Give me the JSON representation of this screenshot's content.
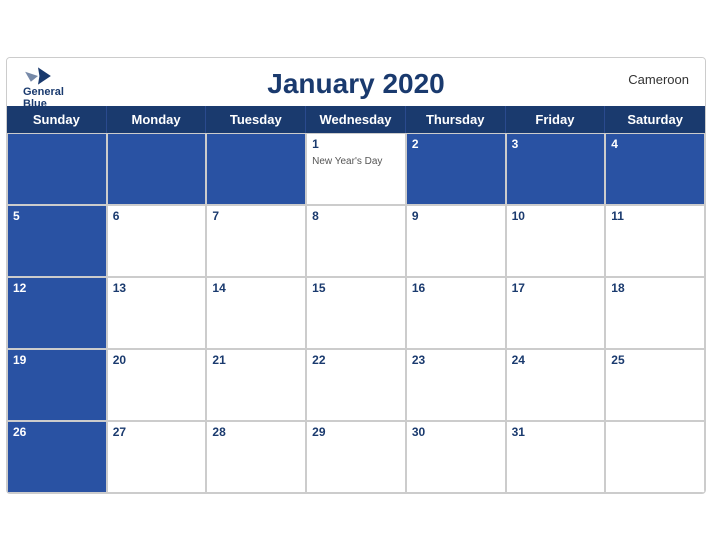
{
  "header": {
    "title": "January 2020",
    "country": "Cameroon",
    "logo_line1": "General",
    "logo_line2": "Blue"
  },
  "days_of_week": [
    "Sunday",
    "Monday",
    "Tuesday",
    "Wednesday",
    "Thursday",
    "Friday",
    "Saturday"
  ],
  "weeks": [
    [
      {
        "num": "",
        "blue": true,
        "event": ""
      },
      {
        "num": "",
        "blue": true,
        "event": ""
      },
      {
        "num": "",
        "blue": true,
        "event": ""
      },
      {
        "num": "1",
        "blue": false,
        "event": "New Year's Day"
      },
      {
        "num": "2",
        "blue": true,
        "event": ""
      },
      {
        "num": "3",
        "blue": true,
        "event": ""
      },
      {
        "num": "4",
        "blue": true,
        "event": ""
      }
    ],
    [
      {
        "num": "5",
        "blue": true,
        "event": ""
      },
      {
        "num": "6",
        "blue": false,
        "event": ""
      },
      {
        "num": "7",
        "blue": false,
        "event": ""
      },
      {
        "num": "8",
        "blue": false,
        "event": ""
      },
      {
        "num": "9",
        "blue": false,
        "event": ""
      },
      {
        "num": "10",
        "blue": false,
        "event": ""
      },
      {
        "num": "11",
        "blue": false,
        "event": ""
      }
    ],
    [
      {
        "num": "12",
        "blue": true,
        "event": ""
      },
      {
        "num": "13",
        "blue": false,
        "event": ""
      },
      {
        "num": "14",
        "blue": false,
        "event": ""
      },
      {
        "num": "15",
        "blue": false,
        "event": ""
      },
      {
        "num": "16",
        "blue": false,
        "event": ""
      },
      {
        "num": "17",
        "blue": false,
        "event": ""
      },
      {
        "num": "18",
        "blue": false,
        "event": ""
      }
    ],
    [
      {
        "num": "19",
        "blue": true,
        "event": ""
      },
      {
        "num": "20",
        "blue": false,
        "event": ""
      },
      {
        "num": "21",
        "blue": false,
        "event": ""
      },
      {
        "num": "22",
        "blue": false,
        "event": ""
      },
      {
        "num": "23",
        "blue": false,
        "event": ""
      },
      {
        "num": "24",
        "blue": false,
        "event": ""
      },
      {
        "num": "25",
        "blue": false,
        "event": ""
      }
    ],
    [
      {
        "num": "26",
        "blue": true,
        "event": ""
      },
      {
        "num": "27",
        "blue": false,
        "event": ""
      },
      {
        "num": "28",
        "blue": false,
        "event": ""
      },
      {
        "num": "29",
        "blue": false,
        "event": ""
      },
      {
        "num": "30",
        "blue": false,
        "event": ""
      },
      {
        "num": "31",
        "blue": false,
        "event": ""
      },
      {
        "num": "",
        "blue": false,
        "event": ""
      }
    ]
  ]
}
